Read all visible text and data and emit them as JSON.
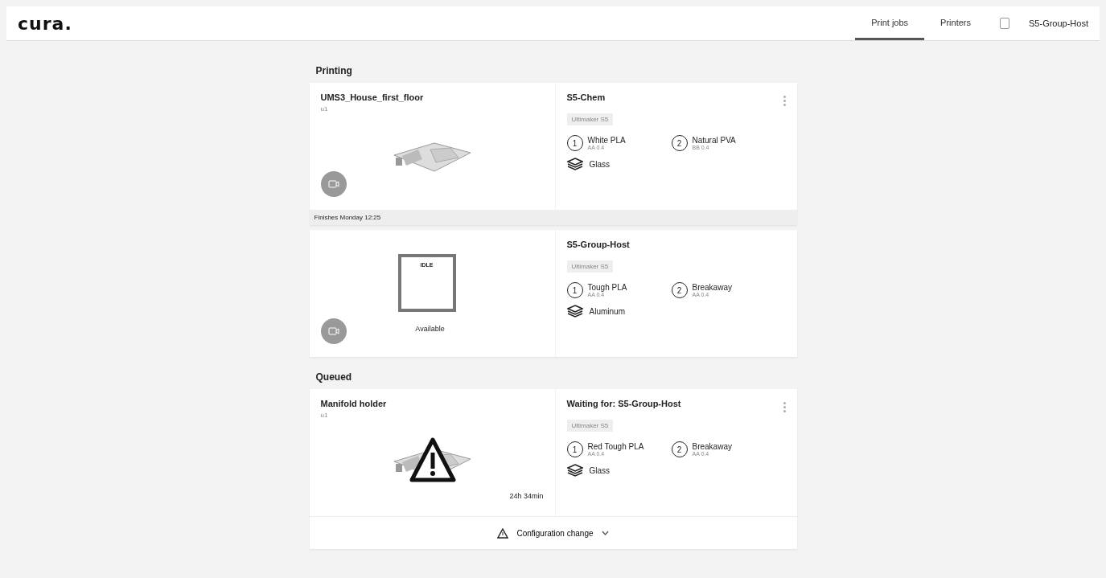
{
  "header": {
    "logo": "cura.",
    "tabs": [
      {
        "label": "Print jobs",
        "selected": true
      },
      {
        "label": "Printers",
        "selected": false
      }
    ],
    "host": "S5-Group-Host"
  },
  "sections": [
    {
      "title": "Printing",
      "cards": [
        {
          "kind": "job",
          "job_name": "UMS3_House_first_floor",
          "owner": "u1",
          "printer_name": "S5-Chem",
          "printer_type": "Ultimaker S5",
          "extruders": [
            {
              "number": "1",
              "material": "White PLA",
              "core": "AA 0.4"
            },
            {
              "number": "2",
              "material": "Natural PVA",
              "core": "BB 0.4"
            }
          ],
          "build_plate": "Glass",
          "progress_text": "Finishes Monday 12:25"
        },
        {
          "kind": "printer",
          "status_word": "IDLE",
          "status": "Available",
          "printer_name": "S5-Group-Host",
          "printer_type": "Ultimaker S5",
          "extruders": [
            {
              "number": "1",
              "material": "Tough PLA",
              "core": "AA 0.4"
            },
            {
              "number": "2",
              "material": "Breakaway",
              "core": "AA 0.4"
            }
          ],
          "build_plate": "Aluminum"
        }
      ]
    },
    {
      "title": "Queued",
      "cards": [
        {
          "kind": "queued",
          "job_name": "Manifold holder",
          "owner": "u1",
          "duration": "24h 34min",
          "printer_name": "Waiting for: S5-Group-Host",
          "printer_type": "Ultimaker S5",
          "extruders": [
            {
              "number": "1",
              "material": "Red Tough PLA",
              "core": "AA 0.4"
            },
            {
              "number": "2",
              "material": "Breakaway",
              "core": "AA 0.4"
            }
          ],
          "build_plate": "Glass",
          "alert": "Configuration change"
        }
      ]
    }
  ]
}
